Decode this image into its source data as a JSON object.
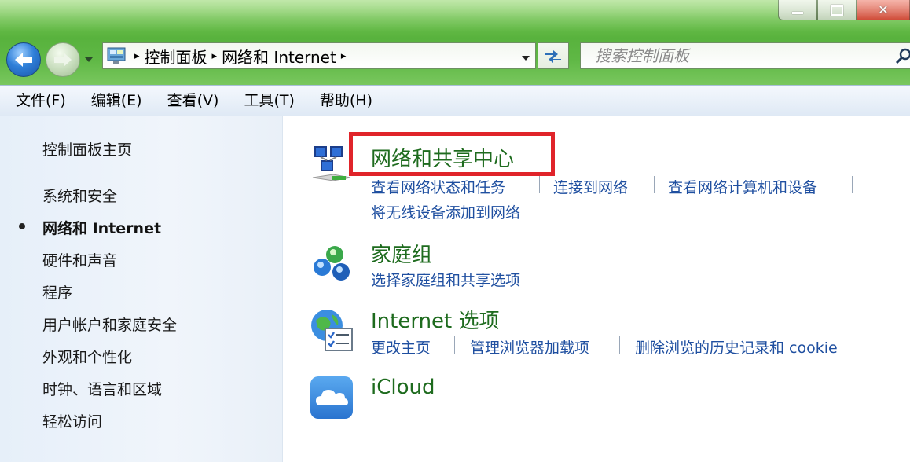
{
  "window": {
    "close_glyph": "✕"
  },
  "address_bar": {
    "crumbs": [
      "控制面板",
      "网络和 Internet"
    ],
    "separator": "▸"
  },
  "search": {
    "placeholder": "搜索控制面板"
  },
  "menu": {
    "items": [
      "文件(F)",
      "编辑(E)",
      "查看(V)",
      "工具(T)",
      "帮助(H)"
    ]
  },
  "sidebar": {
    "home": "控制面板主页",
    "items": [
      "系统和安全",
      "网络和 Internet",
      "硬件和声音",
      "程序",
      "用户帐户和家庭安全",
      "外观和个性化",
      "时钟、语言和区域",
      "轻松访问"
    ],
    "current_index": 1
  },
  "categories": [
    {
      "icon": "network-sharing-icon",
      "title": "网络和共享中心",
      "links": [
        "查看网络状态和任务",
        "连接到网络",
        "查看网络计算机和设备",
        "将无线设备添加到网络"
      ]
    },
    {
      "icon": "homegroup-icon",
      "title": "家庭组",
      "links": [
        "选择家庭组和共享选项"
      ]
    },
    {
      "icon": "internet-options-icon",
      "title": "Internet 选项",
      "links": [
        "更改主页",
        "管理浏览器加载项",
        "删除浏览的历史记录和 cookie"
      ]
    },
    {
      "icon": "icloud-icon",
      "title": "iCloud",
      "links": []
    }
  ],
  "colors": {
    "title_bar_green": "#5fb845",
    "category_title": "#1e6b1e",
    "link_blue": "#1f4fa0",
    "highlight_red": "#e0242a"
  }
}
